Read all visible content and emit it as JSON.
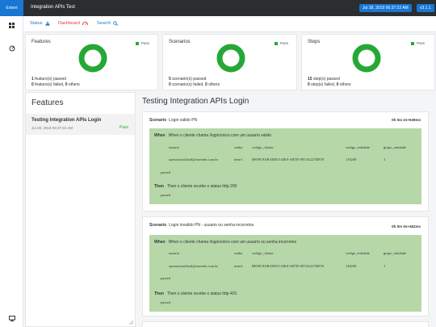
{
  "app": {
    "brand": "Extent",
    "title": "Integration APIs Test",
    "date": "Jul 28, 2019 06:37:22 AM",
    "version": "v3.1.1"
  },
  "nav": {
    "status": "Status",
    "dashboard": "Dashboard",
    "search": "Search"
  },
  "summary": [
    {
      "title": "Features",
      "legend": "Pass",
      "line1_count": "1",
      "line1_text": " feature(s) passed",
      "line2_a": "0",
      "line2_b": " feature(s) failed, ",
      "line2_c": "0",
      "line2_d": " others",
      "pass_fraction": 1.0
    },
    {
      "title": "Scenarios",
      "legend": "Pass",
      "line1_count": "5",
      "line1_text": " scenario(s) passed",
      "line2_a": "0",
      "line2_b": " scenario(s) failed, ",
      "line2_c": "0",
      "line2_d": " others",
      "pass_fraction": 1.0
    },
    {
      "title": "Steps",
      "legend": "Pass",
      "line1_count": "15",
      "line1_text": " step(s) passed",
      "line2_a": "0",
      "line2_b": " step(s) failed, ",
      "line2_c": "0",
      "line2_d": " others",
      "pass_fraction": 1.0
    }
  ],
  "features_panel": {
    "title": "Features",
    "item": {
      "name": "Testing Integration APIs Login",
      "date": "Jul 28, 2019 06:37:22 AM",
      "status": "Pass"
    }
  },
  "detail": {
    "title": "Testing Integration APIs Login",
    "scenarios": [
      {
        "keyword": "Scenario",
        "name": "Login valido PN",
        "duration": "0h 0m 2s+639ms",
        "when_kw": "When",
        "when_text": "When o cliente chama /login/unico com um usuario valido",
        "headers": [
          "usuario",
          "senha",
          "codigo_cliente",
          "codigo_entidade",
          "grupo_entidade"
        ],
        "row": [
          "operacional.bnfi@nortedo.com.br",
          "teste1",
          "BF09C9AB-DEE3-43E0-AB7D-0974A227DF59",
          "118249",
          "1"
        ],
        "passed1": "passed",
        "then_kw": "Then",
        "then_text": "Then o cliente recebe o status http 200",
        "passed2": "passed"
      },
      {
        "keyword": "Scenario",
        "name": "Login invalido PN - usuario ou senha incorretos",
        "duration": "0h 0m 0s+462ms",
        "when_kw": "When",
        "when_text": "When o cliente chama /login/unico com um usuario ou senha incorretos",
        "headers": [
          "usuario",
          "senha",
          "codigo_cliente",
          "codigo_entidade",
          "grupo_entidade"
        ],
        "row": [
          "operacional.bnfi@nortedo.com.br",
          "teste2",
          "BF09C9AB-DEE3-43E0-AB7D-0974A227DF59",
          "118249",
          "1"
        ],
        "passed1": "passed",
        "then_kw": "Then",
        "then_text": "Then o cliente recebe o status http 401",
        "passed2": "passed"
      }
    ]
  },
  "colors": {
    "accent": "#1976d2",
    "pass": "#25a836",
    "step_bg": "#b6d7a8",
    "topbar": "#2b2d30"
  },
  "icons": {
    "status": "warning-triangle-icon",
    "dashboard": "gauge-icon",
    "search": "search-icon",
    "rail1": "grid-icon",
    "rail2": "dashboard-icon",
    "rail3": "monitor-icon"
  }
}
